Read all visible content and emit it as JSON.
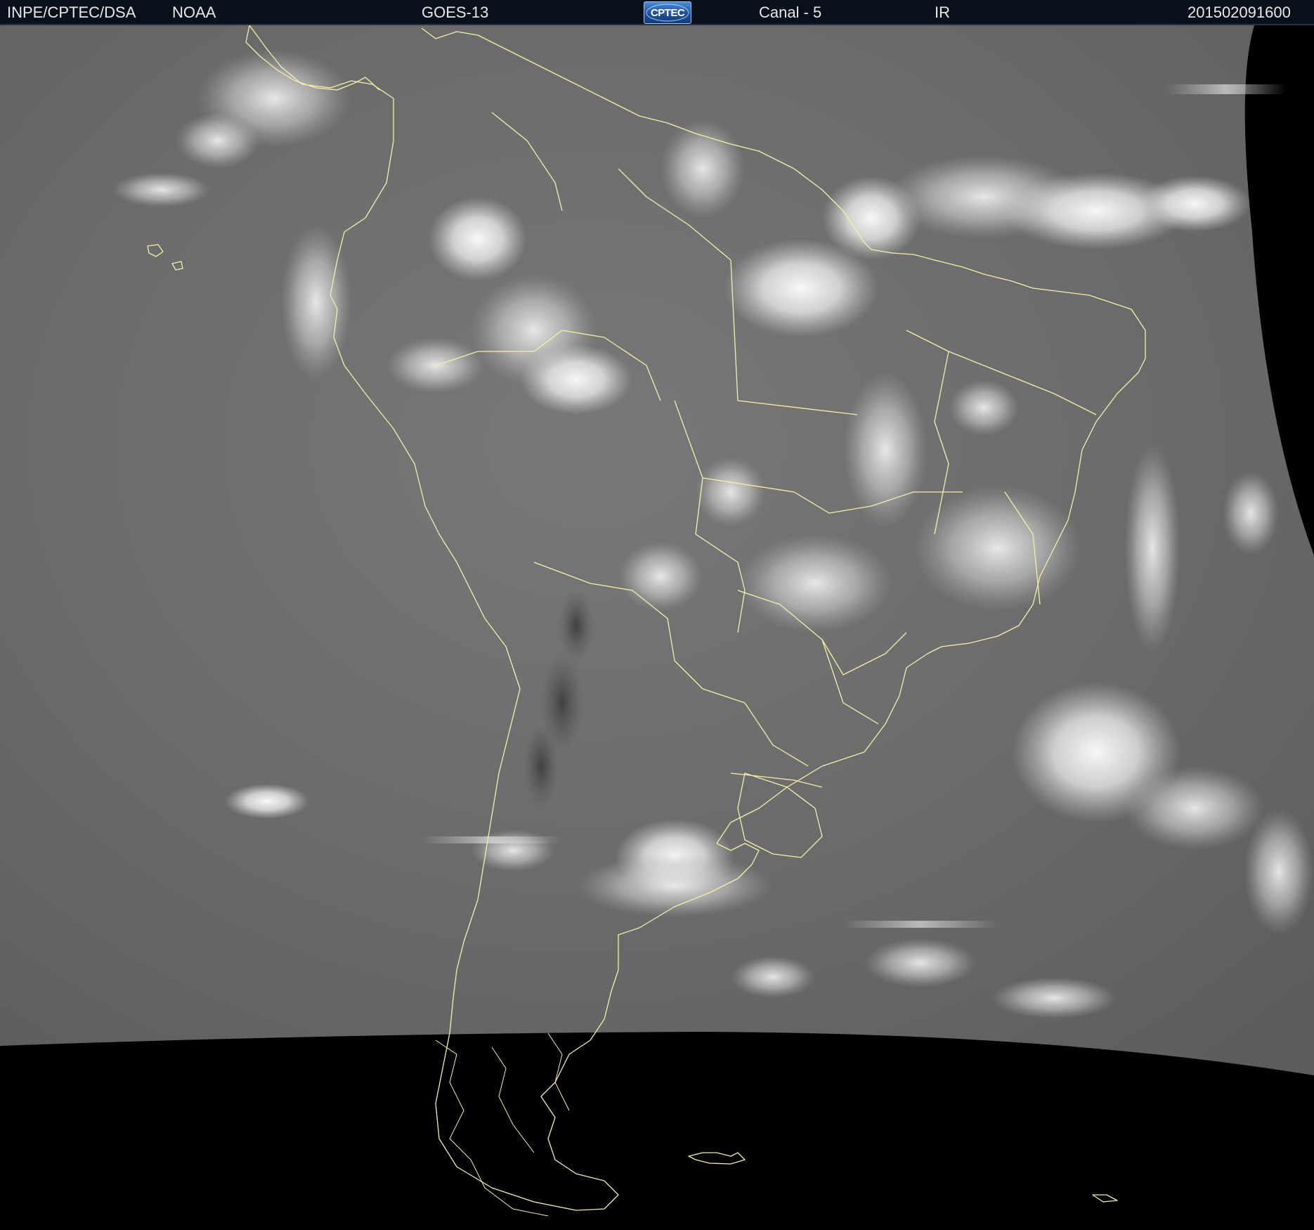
{
  "header": {
    "source": "INPE/CPTEC/DSA",
    "agency": "NOAA",
    "satellite": "GOES-13",
    "logo_text": "CPTEC",
    "channel": "Canal - 5",
    "band": "IR",
    "timestamp": "201502091600"
  },
  "image": {
    "description_type": "infrared satellite image",
    "coastline_color": "#f5f0a8",
    "earth_gray": "#6d6d6d",
    "space_color": "#000000",
    "cloud_color": "#f2f2f2"
  }
}
